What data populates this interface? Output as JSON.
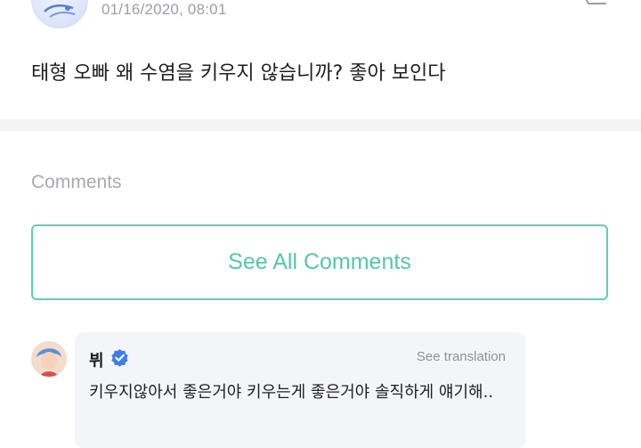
{
  "post": {
    "time": "01/16/2020, 08:01",
    "body": "태형 오빠 왜 수염을 키우지 않습니까?  좋아 보인다"
  },
  "comments_section": {
    "heading": "Comments",
    "see_all_label": "See All Comments"
  },
  "comment": {
    "author": "뷔",
    "see_translation_label": "See translation",
    "text": "키우지않아서 좋은거야 키우는게 좋은거야 솔직하게 얘기해.."
  },
  "colors": {
    "accent": "#5fcdb4",
    "verified": "#3d7bf0",
    "bubble_bg": "#f4f5f9",
    "divider": "#f2f3f5"
  },
  "icons": {
    "more": "more-icon",
    "verified": "verified-badge-icon"
  }
}
